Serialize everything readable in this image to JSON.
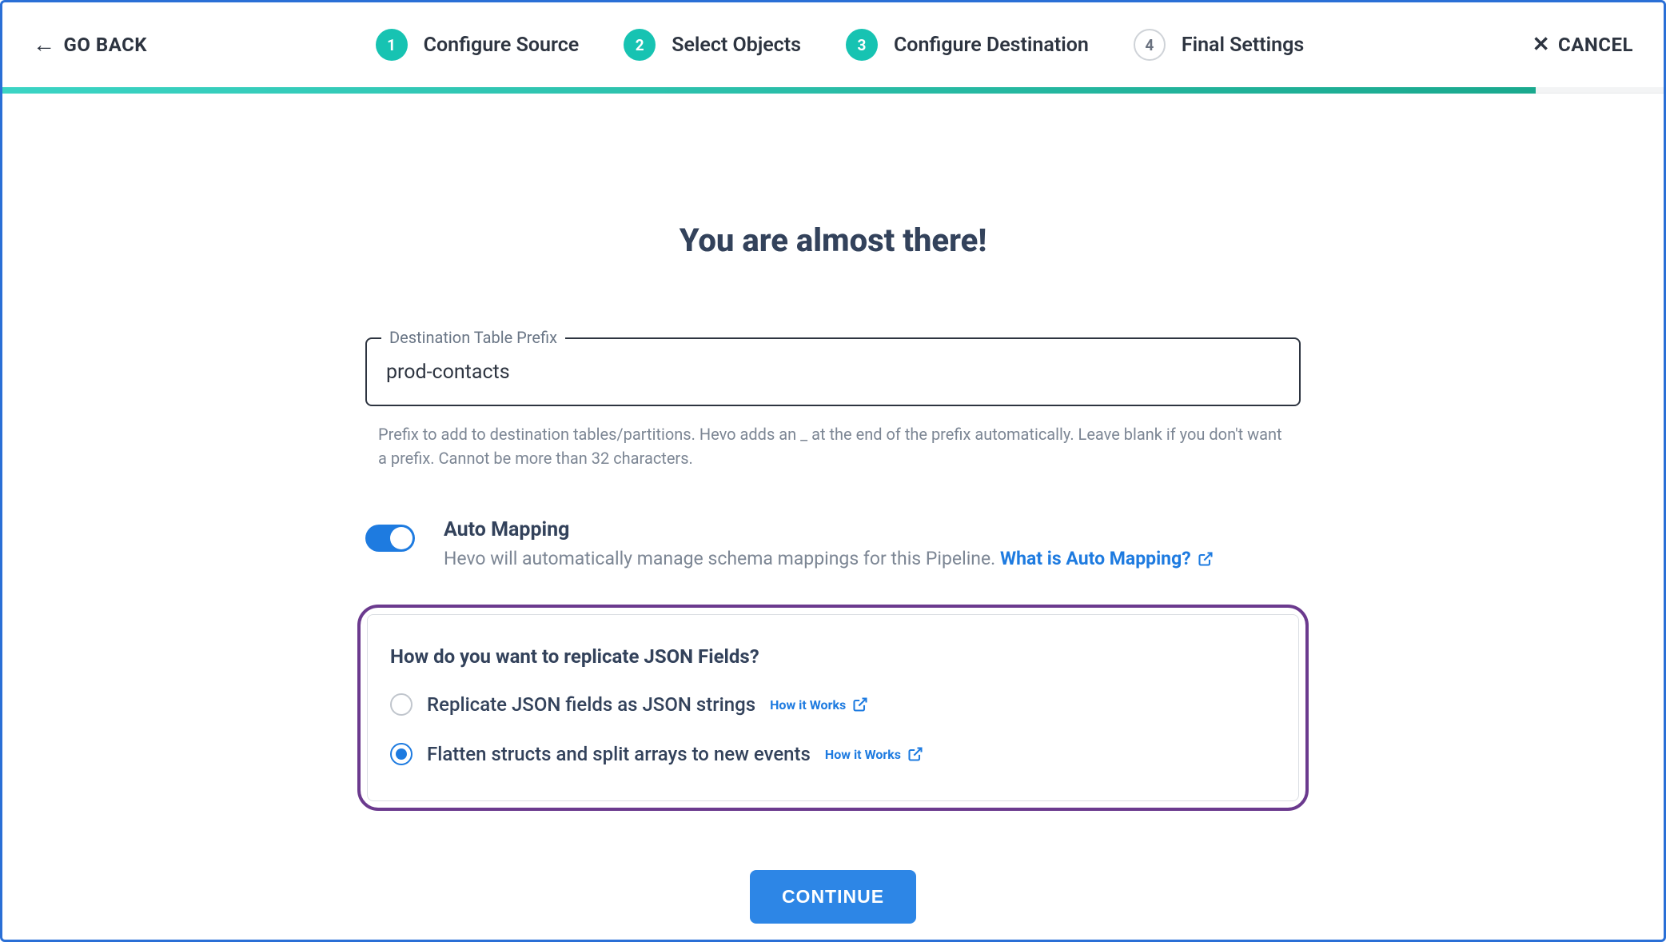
{
  "header": {
    "go_back": "GO BACK",
    "cancel": "CANCEL",
    "steps": [
      {
        "num": "1",
        "label": "Configure Source",
        "status": "done"
      },
      {
        "num": "2",
        "label": "Select Objects",
        "status": "done"
      },
      {
        "num": "3",
        "label": "Configure Destination",
        "status": "done"
      },
      {
        "num": "4",
        "label": "Final Settings",
        "status": "pending"
      }
    ],
    "progress_percent": 92.3
  },
  "main": {
    "title": "You are almost there!",
    "prefix_field": {
      "label": "Destination Table Prefix",
      "value": "prod-contacts",
      "helper": "Prefix to add to destination tables/partitions. Hevo adds an _ at the end of the prefix automatically. Leave blank if you don't want a prefix. Cannot be more than 32 characters."
    },
    "auto_mapping": {
      "title": "Auto Mapping",
      "desc": "Hevo will automatically manage schema mappings for this Pipeline. ",
      "link": "What is Auto Mapping?",
      "enabled": true
    },
    "json_panel": {
      "title": "How do you want to replicate JSON Fields?",
      "options": [
        {
          "label": "Replicate JSON fields as JSON strings",
          "link": "How it Works",
          "checked": false
        },
        {
          "label": "Flatten structs and split arrays to new events",
          "link": "How it Works",
          "checked": true
        }
      ]
    },
    "continue": "CONTINUE"
  },
  "colors": {
    "accent_teal": "#17c3b2",
    "accent_blue": "#1e7be0",
    "panel_border": "#6b3a8e"
  }
}
